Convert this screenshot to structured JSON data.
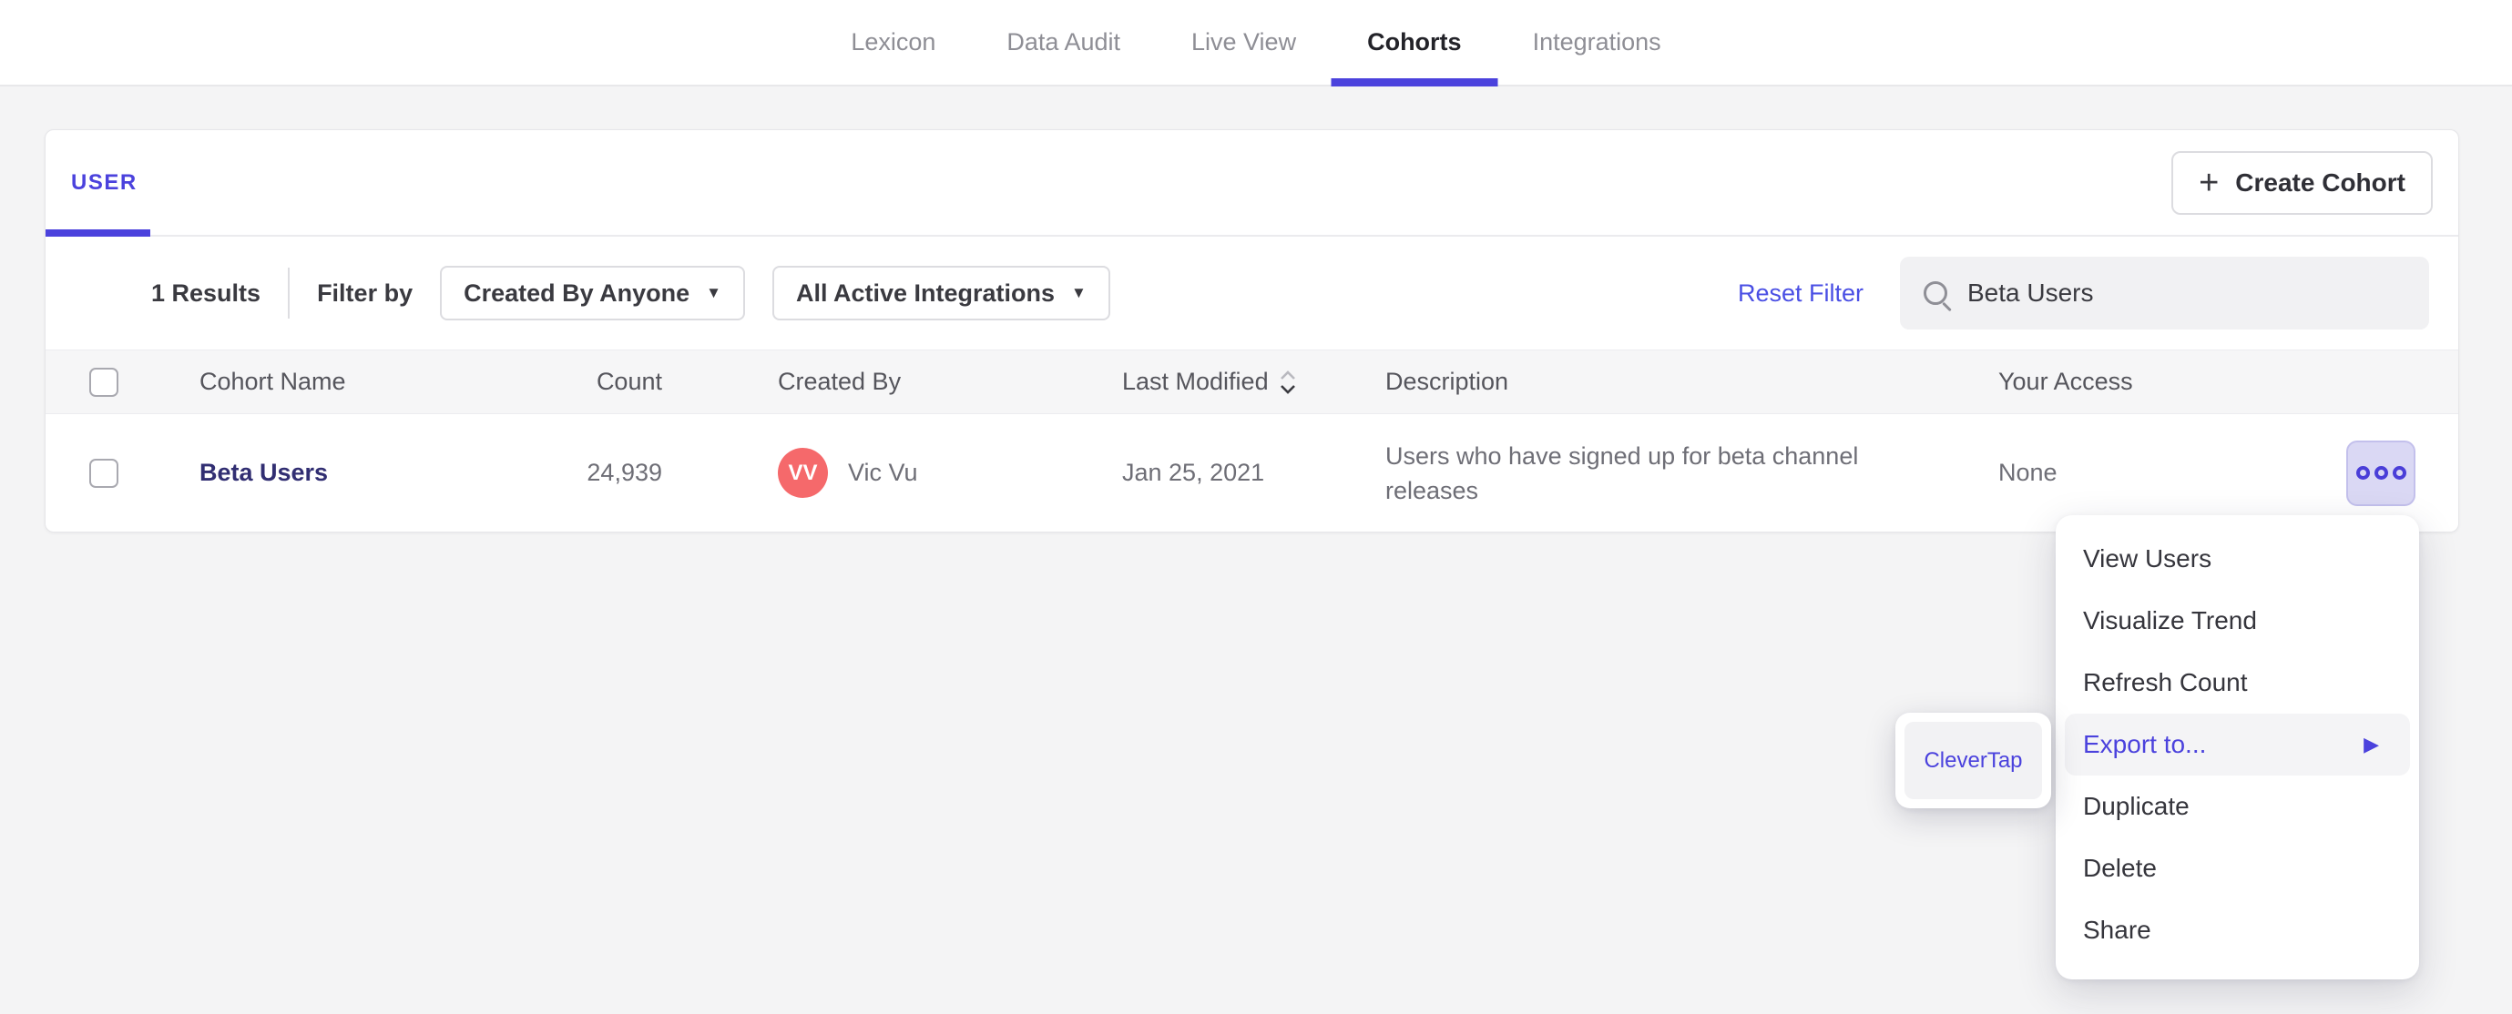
{
  "colors": {
    "accent": "#4b42dd",
    "link": "#4a4fe4",
    "cohort-link": "#312e72",
    "avatar-bg": "#f5696b",
    "page-bg": "#f4f4f5"
  },
  "nav": {
    "active_tab": "Cohorts",
    "tabs": [
      {
        "label": "Lexicon"
      },
      {
        "label": "Data Audit"
      },
      {
        "label": "Live View"
      },
      {
        "label": "Cohorts"
      },
      {
        "label": "Integrations"
      }
    ]
  },
  "panel": {
    "tabs": [
      {
        "label": "USER"
      }
    ],
    "create_button": {
      "label": "Create Cohort",
      "icon": "plus-icon",
      "plus_glyph": "+"
    },
    "toolbar": {
      "results_count": "1 Results",
      "filter_by_label": "Filter by",
      "created_by_filter": {
        "value": "Created By Anyone",
        "caret": "▼"
      },
      "integrations_filter": {
        "value": "All Active Integrations",
        "caret": "▼"
      },
      "reset_filter_label": "Reset Filter",
      "search": {
        "value": "Beta Users",
        "icon": "search-icon"
      }
    },
    "table": {
      "columns": [
        {
          "label": "Cohort Name"
        },
        {
          "label": "Count"
        },
        {
          "label": "Created By"
        },
        {
          "label": "Last Modified",
          "sortable": true
        },
        {
          "label": "Description"
        },
        {
          "label": "Your Access"
        }
      ],
      "rows": [
        {
          "name": "Beta Users",
          "count": "24,939",
          "created_by": {
            "initials": "VV",
            "name": "Vic Vu"
          },
          "last_modified": "Jan 25, 2021",
          "description": "Users who have signed up for beta channel releases",
          "access": "None"
        }
      ]
    }
  },
  "context_menu": {
    "items": [
      {
        "label": "View Users"
      },
      {
        "label": "Visualize Trend"
      },
      {
        "label": "Refresh Count"
      },
      {
        "label": "Export to...",
        "highlighted": true,
        "submenu_arrow": "▶"
      },
      {
        "label": "Duplicate"
      },
      {
        "label": "Delete"
      },
      {
        "label": "Share"
      }
    ],
    "submenu": {
      "items": [
        {
          "label": "CleverTap"
        }
      ]
    }
  }
}
